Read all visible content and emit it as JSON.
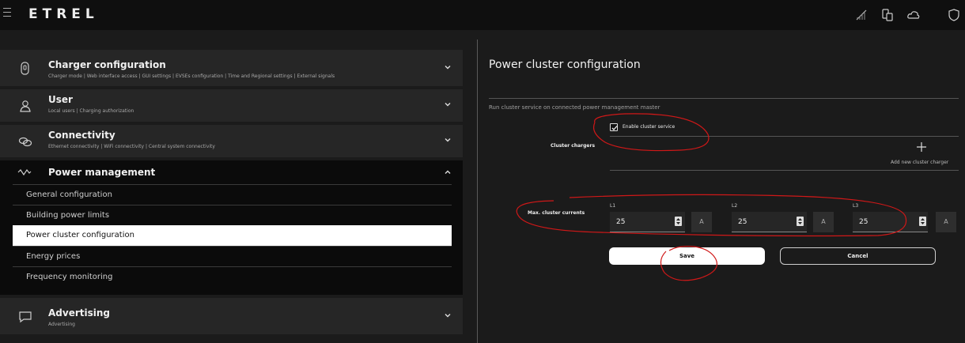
{
  "app": {
    "logo_text": "ETREL"
  },
  "header_icons": [
    "signal-off-icon",
    "devices-icon",
    "cloud-icon",
    "shield-icon"
  ],
  "nav": {
    "charger_config": {
      "title": "Charger configuration",
      "subtitle": "Charger mode  |  Web interface access  |  GUI settings  |  EVSEs configuration  |  Time and Regional settings  |  External signals"
    },
    "user": {
      "title": "User",
      "subtitle": "Local users  |  Charging authorization"
    },
    "connectivity": {
      "title": "Connectivity",
      "subtitle": "Ethernet connectivity  |  WiFi connectivity  |  Central system connectivity"
    },
    "power_management": {
      "title": "Power management",
      "items": [
        {
          "label": "General configuration"
        },
        {
          "label": "Building power limits"
        },
        {
          "label": "Power cluster configuration"
        },
        {
          "label": "Energy prices"
        },
        {
          "label": "Frequency monitoring"
        }
      ]
    },
    "advertising": {
      "title": "Advertising",
      "subtitle": "Advertising"
    }
  },
  "panel": {
    "title": "Power cluster configuration",
    "description": "Run cluster service on connected power management master",
    "enable_label": "Enable cluster service",
    "enable_checked": true,
    "cluster_chargers_label": "Cluster chargers",
    "add_charger_label": "Add new cluster charger",
    "max_currents_label": "Max. cluster currents",
    "phases": [
      {
        "label": "L1",
        "value": "25",
        "unit": "A"
      },
      {
        "label": "L2",
        "value": "25",
        "unit": "A"
      },
      {
        "label": "L3",
        "value": "25",
        "unit": "A"
      }
    ],
    "save_label": "Save",
    "cancel_label": "Cancel"
  },
  "colors": {
    "annotation": "#d01818",
    "background": "#1b1b1b",
    "active_item": "#ffffff"
  }
}
